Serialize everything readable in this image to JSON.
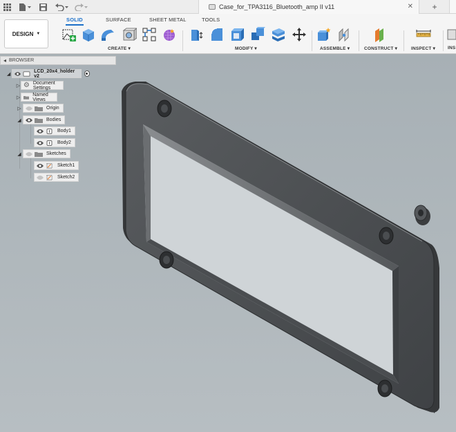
{
  "title_bar": {
    "document_title": "Case_for_TPA3116_Bluetooth_amp II v11"
  },
  "toolbar": {
    "workspace_button": "DESIGN",
    "tabs": [
      "SOLID",
      "SURFACE",
      "SHEET METAL",
      "TOOLS"
    ],
    "active_tab": "SOLID",
    "groups": [
      "CREATE",
      "MODIFY",
      "ASSEMBLE",
      "CONSTRUCT",
      "INSPECT",
      "INS"
    ],
    "accent_color": "#1b6fc9"
  },
  "browser": {
    "header": "BROWSER",
    "root": "LCD_20x4_holder v2",
    "items": [
      {
        "label": "Document Settings",
        "icon": "gear-icon"
      },
      {
        "label": "Named Views",
        "icon": "folder-icon"
      },
      {
        "label": "Origin",
        "icon": "folder-icon"
      },
      {
        "label": "Bodies",
        "icon": "folder-icon"
      },
      {
        "label": "Body1",
        "icon": "body-icon"
      },
      {
        "label": "Body2",
        "icon": "body-icon"
      },
      {
        "label": "Sketches",
        "icon": "folder-icon"
      },
      {
        "label": "Sketch1",
        "icon": "sketch-icon"
      },
      {
        "label": "Sketch2",
        "icon": "sketch-icon"
      }
    ]
  }
}
